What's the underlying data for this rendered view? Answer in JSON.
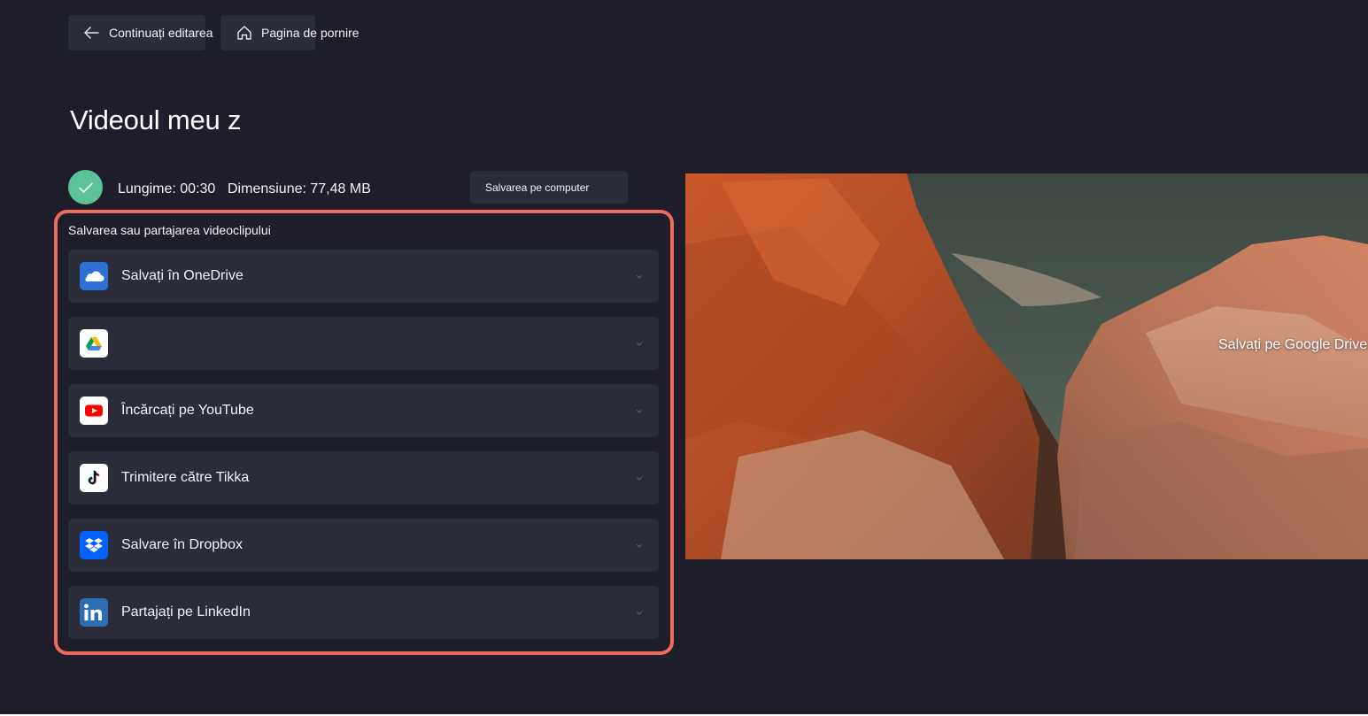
{
  "header": {
    "back_label": "Continuați editarea",
    "home_label": "Pagina de pornire"
  },
  "project": {
    "title": "Videoul meu z",
    "length": "Lungime: 00:30",
    "size": "Dimensiune: 77,48 MB",
    "status_icon": "check-icon",
    "save_computer_label": "Salvarea pe computer"
  },
  "share": {
    "section_label": "Salvarea sau partajarea videoclipului",
    "items": [
      {
        "label": "Salvați în OneDrive",
        "icon": "onedrive-icon"
      },
      {
        "label": "",
        "icon": "google-drive-icon"
      },
      {
        "label": "Încărcați pe YouTube",
        "icon": "youtube-icon"
      },
      {
        "label": "Trimitere către Tikka",
        "icon": "tiktok-icon"
      },
      {
        "label": "Salvare în Dropbox",
        "icon": "dropbox-icon"
      },
      {
        "label": "Partajați pe LinkedIn",
        "icon": "linkedin-icon"
      }
    ]
  },
  "preview": {
    "overlay_label": "Salvați pe Google Drive"
  },
  "colors": {
    "background": "#1d1e29",
    "panel": "#2b2c3a",
    "highlight_border": "#ee6a5c",
    "success": "#5cc398"
  }
}
